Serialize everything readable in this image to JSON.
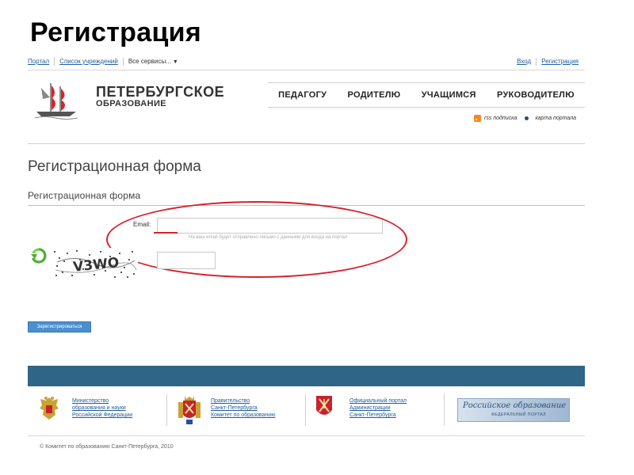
{
  "slide_title": "Регистрация",
  "topnav": {
    "left_links": [
      "Портал",
      "Список учреждений"
    ],
    "services_dropdown": "Все сервисы...",
    "right_links": [
      "Вход",
      "Регистрация"
    ]
  },
  "logo": {
    "line1": "ПЕТЕРБУРГСКОЕ",
    "line2": "ОБРАЗОВАНИЕ",
    "icon": "ship-icon"
  },
  "main_menu": [
    "ПЕДАГОГУ",
    "РОДИТЕЛЮ",
    "УЧАЩИМСЯ",
    "РУКОВОДИТЕЛЮ"
  ],
  "utility_links": {
    "rss": "rss подписка",
    "sitemap": "карта портала"
  },
  "form": {
    "heading": "Регистрационная форма",
    "subheading": "Регистрационная форма",
    "email_label": "Email:",
    "email_value": "",
    "email_hint": "На ваш email будет отправлено письмо с данными для входа на портал",
    "captcha_text": "V3WO",
    "captcha_input_value": "",
    "submit_label": "Зарегистрироваться"
  },
  "footer": {
    "links": [
      {
        "lines": [
          "Министерство",
          "образования и науки",
          "Российской Федерации"
        ],
        "icon": "russian-eagle-emblem-icon"
      },
      {
        "lines": [
          "Правительство",
          "Санкт-Петербурга",
          "Комитет по образованию"
        ],
        "icon": "spb-coat-of-arms-icon"
      },
      {
        "lines": [
          "Официальный портал",
          "Администрации",
          "Санкт-Петербурга"
        ],
        "icon": "spb-shield-icon"
      }
    ],
    "banner": {
      "title": "Российское образование",
      "subtitle": "ФЕДЕРАЛЬНЫЙ ПОРТАЛ"
    }
  },
  "copyright": "© Комитет по образованию Санкт-Петербурга, 2010",
  "colors": {
    "link": "#1f5c9e",
    "footer_bar": "#2f6586",
    "highlight_red": "#d81e2c",
    "button": "#4a8fd0",
    "rss": "#f08a24"
  }
}
